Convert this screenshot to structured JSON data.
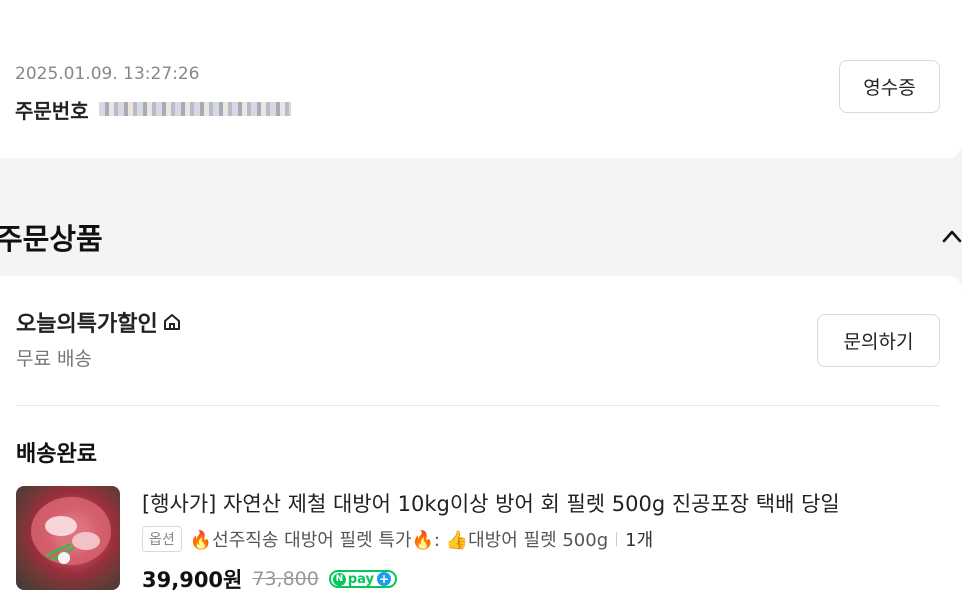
{
  "order": {
    "date": "2025.01.09. 13:27:26",
    "number_label": "주문번호",
    "receipt_label": "영수증"
  },
  "section": {
    "title": "주문상품"
  },
  "store": {
    "name": "오늘의특가할인",
    "shipping": "무료 배송",
    "inquiry_label": "문의하기"
  },
  "item": {
    "status": "배송완료",
    "name": "[행사가] 자연산 제철 대방어 10kg이상 방어 회 필렛 500g 진공포장 택배 당일",
    "option_tag": "옵션",
    "option_text": "🔥선주직송 대방어 필렛 특가🔥: 👍대방어 필렛 500g",
    "quantity": "1개",
    "price": "39,900원",
    "original_price": "73,800",
    "npay_label": "pay"
  },
  "colors": {
    "npay_green": "#03c75a",
    "npay_plus_blue": "#1a9cf0"
  }
}
